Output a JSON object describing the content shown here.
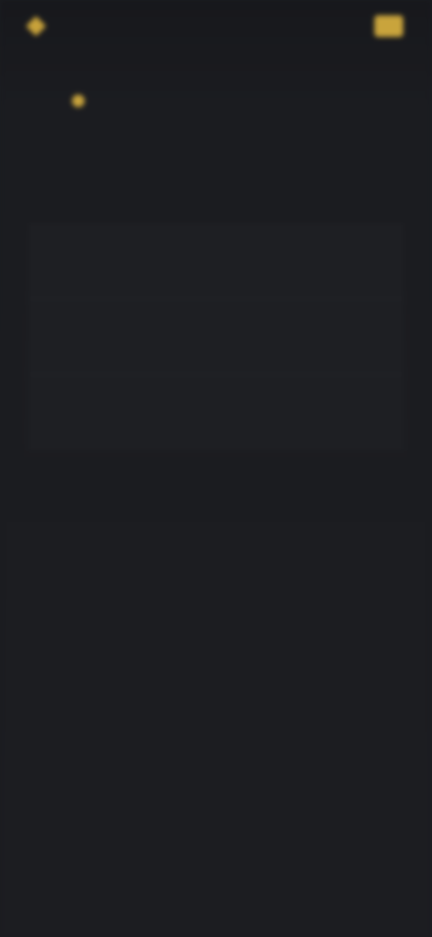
{
  "header": {
    "brand_name": "",
    "login_label": "",
    "signup_label": ""
  },
  "hero": {
    "title": "",
    "subtitle": ""
  },
  "list": {
    "items": [
      {
        "label": "",
        "value": ""
      },
      {
        "label": "",
        "value": ""
      },
      {
        "label": "",
        "value": ""
      }
    ]
  },
  "colors": {
    "background": "#1b1c20",
    "accent": "#c9a43c",
    "text": "#d8d9dd",
    "muted": "#8b8d93"
  }
}
